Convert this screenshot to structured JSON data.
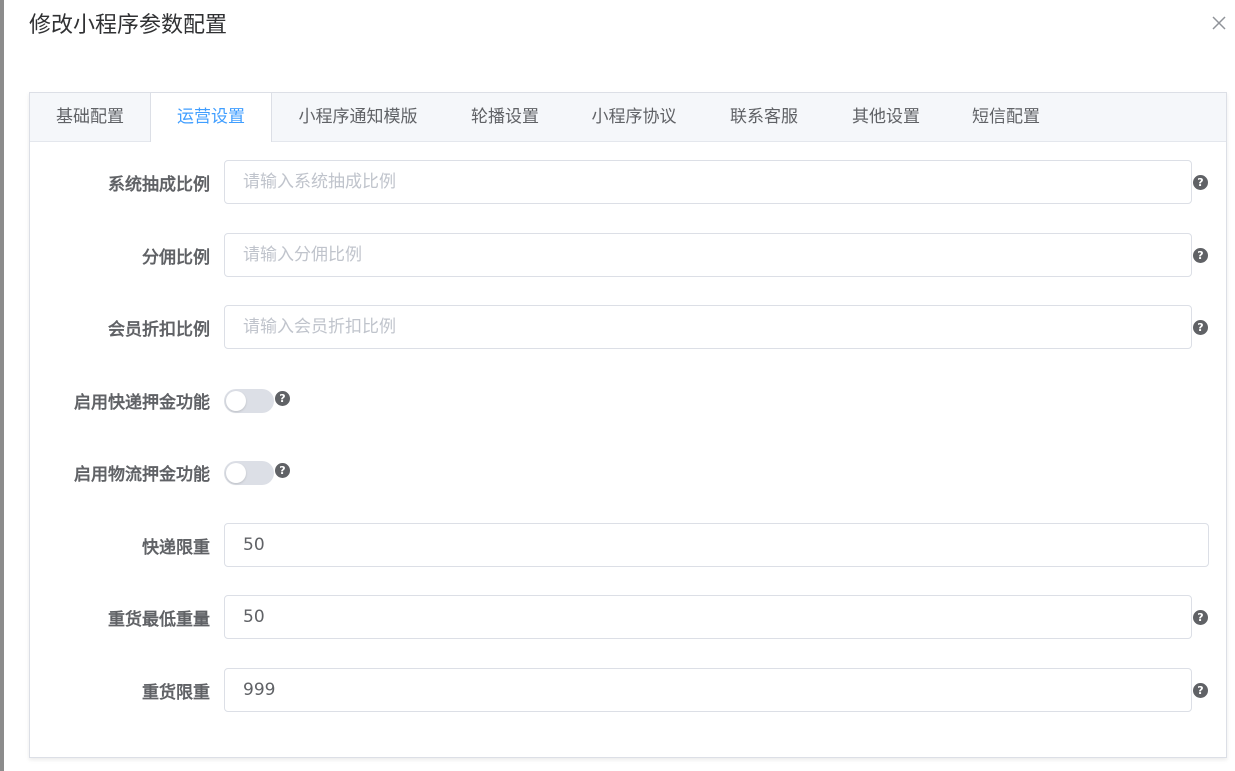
{
  "dialog": {
    "title": "修改小程序参数配置"
  },
  "tabs": [
    {
      "label": "基础配置",
      "active": false
    },
    {
      "label": "运营设置",
      "active": true
    },
    {
      "label": "小程序通知模版",
      "active": false
    },
    {
      "label": "轮播设置",
      "active": false
    },
    {
      "label": "小程序协议",
      "active": false
    },
    {
      "label": "联系客服",
      "active": false
    },
    {
      "label": "其他设置",
      "active": false
    },
    {
      "label": "短信配置",
      "active": false
    }
  ],
  "form": {
    "commission_rate": {
      "label": "系统抽成比例",
      "value": "",
      "placeholder": "请输入系统抽成比例"
    },
    "distribution_rate": {
      "label": "分佣比例",
      "value": "",
      "placeholder": "请输入分佣比例"
    },
    "member_discount": {
      "label": "会员折扣比例",
      "value": "",
      "placeholder": "请输入会员折扣比例"
    },
    "express_deposit": {
      "label": "启用快递押金功能",
      "enabled": false
    },
    "logistics_deposit": {
      "label": "启用物流押金功能",
      "enabled": false
    },
    "express_limit": {
      "label": "快递限重",
      "value": "50"
    },
    "heavy_min_weight": {
      "label": "重货最低重量",
      "value": "50"
    },
    "heavy_limit": {
      "label": "重货限重",
      "value": "999"
    }
  },
  "icons": {
    "close": "close-icon",
    "help": "question-circle-icon"
  },
  "colors": {
    "accent": "#409eff",
    "tab_bar_bg": "#f5f7fa",
    "switch_off": "#dcdfe6"
  }
}
